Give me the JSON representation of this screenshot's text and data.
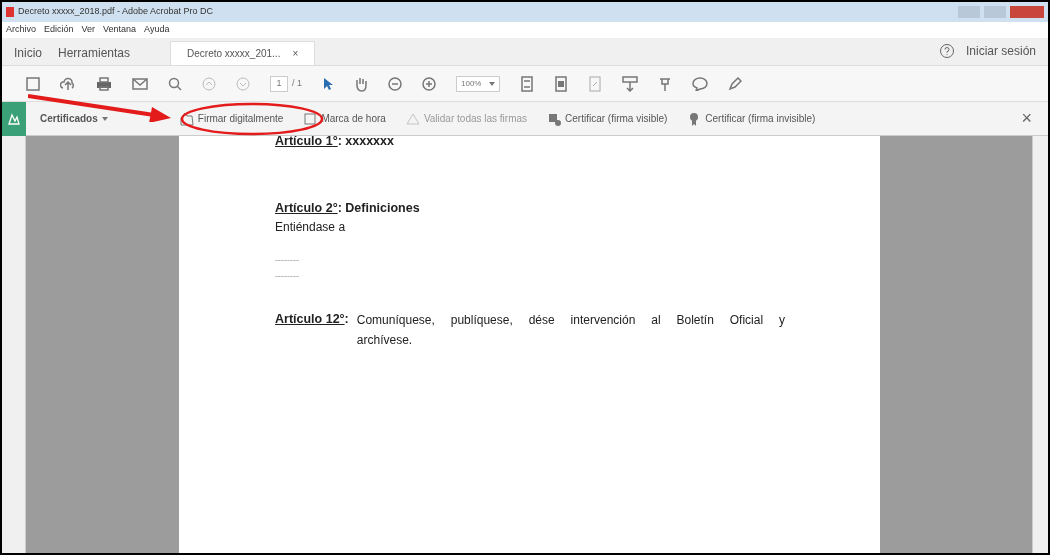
{
  "window": {
    "title": "Decreto xxxxx_2018.pdf - Adobe Acrobat Pro DC"
  },
  "menu": [
    "Archivo",
    "Edición",
    "Ver",
    "Ventana",
    "Ayuda"
  ],
  "tabs": [
    {
      "label": "Inicio",
      "selected": false
    },
    {
      "label": "Herramientas",
      "selected": false
    },
    {
      "label": "Decreto xxxxx_201...",
      "selected": true,
      "close": "×"
    }
  ],
  "sign_in": "Iniciar sesión",
  "toolbar": {
    "page": "1",
    "page_total": "/ 1",
    "zoom": "100%"
  },
  "certificates_bar": {
    "title": "Certificados",
    "tools": [
      {
        "label": "Firmar digitalmente",
        "disabled": false
      },
      {
        "label": "Marca de hora",
        "disabled": false
      },
      {
        "label": "Validar todas las firmas",
        "disabled": true
      },
      {
        "label": "Certificar (firma visible)",
        "disabled": false
      },
      {
        "label": "Certificar (firma invisible)",
        "disabled": false
      }
    ],
    "close": "×"
  },
  "document": {
    "articles": [
      {
        "label": "Artículo 1°",
        "title": ": xxxxxxx"
      },
      {
        "label": "Artículo 2°",
        "title": ": Definiciones",
        "lines": [
          "Entiéndase a",
          "--------",
          "--------"
        ]
      },
      {
        "label": "Artículo 12°",
        "title": ":",
        "body": "Comuníquese, publíquese, dése intervención al Boletín Oficial y archívese."
      }
    ]
  }
}
